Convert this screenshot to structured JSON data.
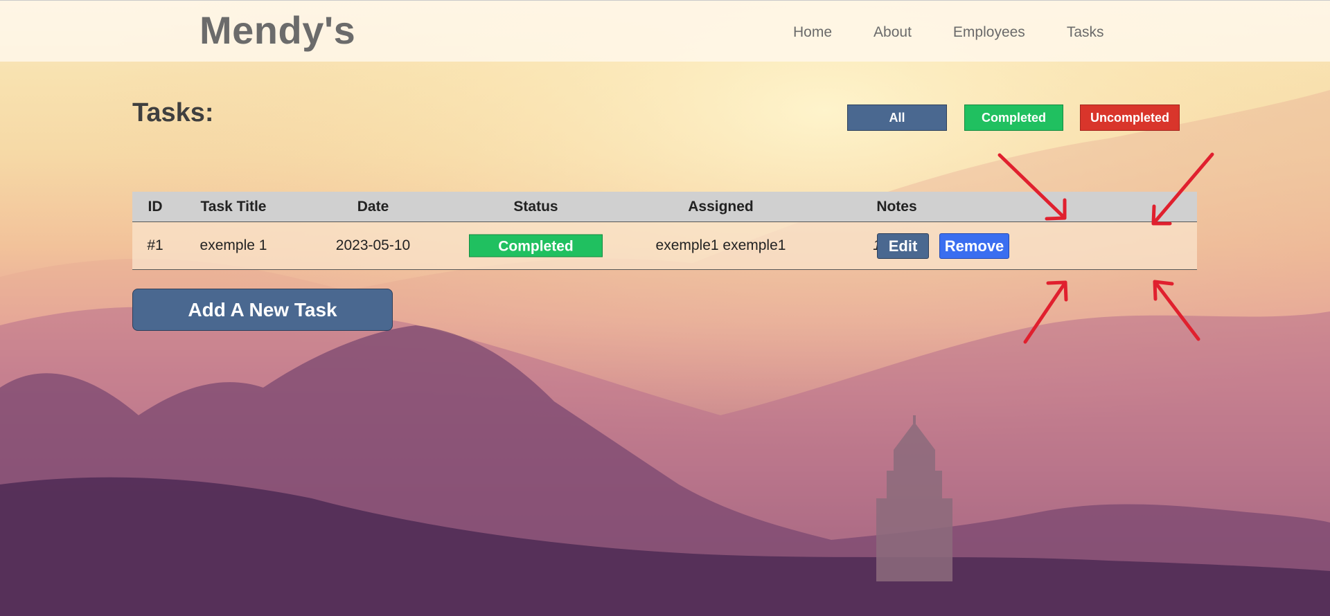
{
  "navbar": {
    "brand": "Mendy's",
    "links": [
      "Home",
      "About",
      "Employees",
      "Tasks"
    ]
  },
  "page": {
    "title": "Tasks:"
  },
  "filters": {
    "all": "All",
    "completed": "Completed",
    "uncompleted": "Uncompleted"
  },
  "table": {
    "headers": [
      "ID",
      "Task Title",
      "Date",
      "Status",
      "Assigned",
      "Notes"
    ],
    "rows": [
      {
        "id": "#1",
        "title": "exemple 1",
        "date": "2023-05-10",
        "status": "Completed",
        "assigned": "exemple1 exemple1",
        "notes": "112233",
        "edit_label": "Edit",
        "remove_label": "Remove"
      }
    ]
  },
  "actions": {
    "add_task_label": "Add A New Task"
  },
  "colors": {
    "primary": "#4a6890",
    "success": "#20c060",
    "danger": "#d9352b",
    "remove": "#3a6ef0",
    "annotation": "#e0202e"
  }
}
